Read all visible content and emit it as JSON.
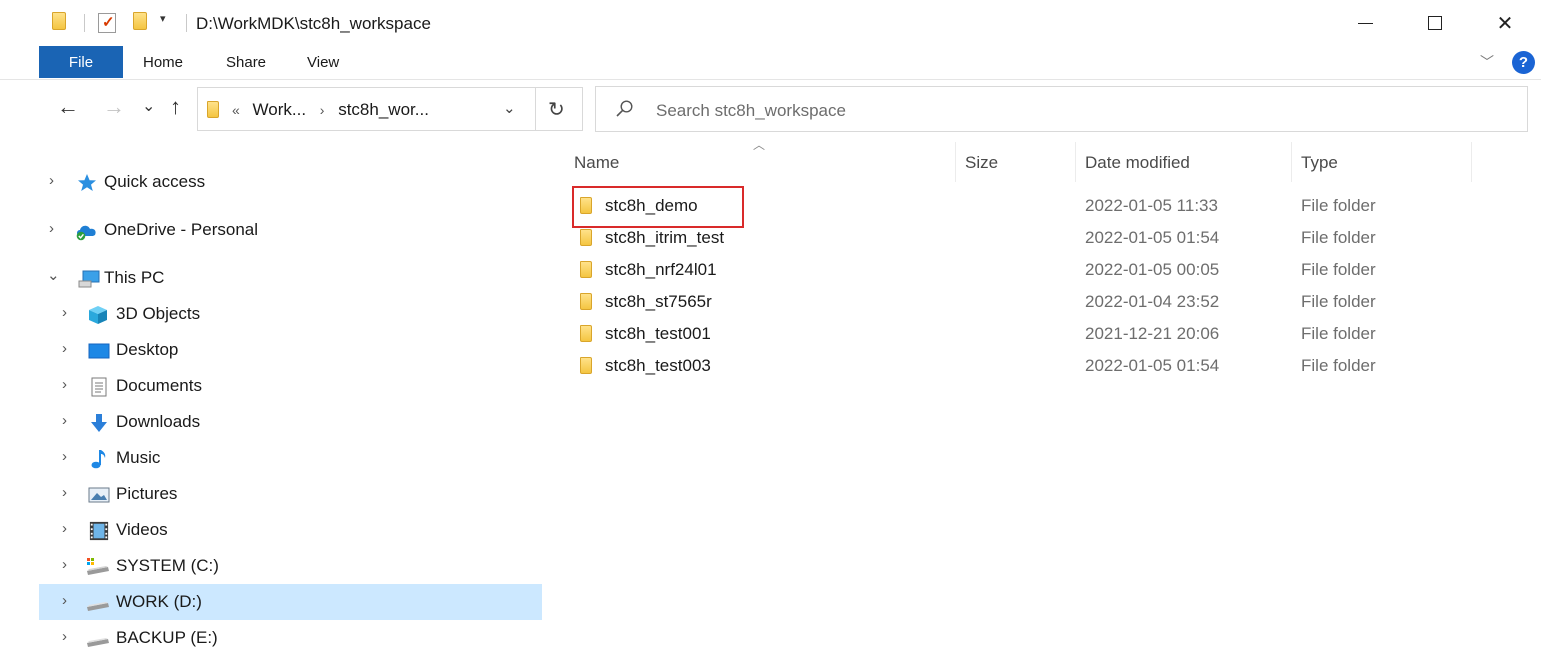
{
  "titlebar": {
    "path": "D:\\WorkMDK\\stc8h_workspace",
    "qa_dropdown": "▾",
    "minimize_icon": "minimize-icon",
    "maximize_icon": "maximize-icon",
    "close_glyph": "✕"
  },
  "ribbon": {
    "tabs": [
      "File",
      "Home",
      "Share",
      "View"
    ],
    "collapse_glyph": "﹀",
    "help_glyph": "?",
    "accent": "#1a64b4"
  },
  "nav": {
    "back_glyph": "←",
    "forward_glyph": "→",
    "recent_glyph": "⌄",
    "up_glyph": "↑",
    "overflow_glyph": "«",
    "breadcrumb": [
      "Work...",
      "stc8h_wor..."
    ],
    "crumb_sep": "›",
    "dropdown_glyph": "⌄",
    "refresh_glyph": "↻",
    "search_placeholder": "Search stc8h_workspace"
  },
  "sidebar": {
    "items": [
      {
        "label": "Quick access",
        "chevron": "›",
        "icon": "star-icon"
      },
      {
        "label": "OneDrive - Personal",
        "chevron": "›",
        "icon": "cloud-icon"
      },
      {
        "label": "This PC",
        "chevron": "⌄",
        "icon": "computer-icon"
      },
      {
        "label": "3D Objects",
        "chevron": "›",
        "icon": "cube-icon"
      },
      {
        "label": "Desktop",
        "chevron": "›",
        "icon": "desktop-icon"
      },
      {
        "label": "Documents",
        "chevron": "›",
        "icon": "document-icon"
      },
      {
        "label": "Downloads",
        "chevron": "›",
        "icon": "download-icon"
      },
      {
        "label": "Music",
        "chevron": "›",
        "icon": "music-icon"
      },
      {
        "label": "Pictures",
        "chevron": "›",
        "icon": "picture-icon"
      },
      {
        "label": "Videos",
        "chevron": "›",
        "icon": "video-icon"
      },
      {
        "label": "SYSTEM (C:)",
        "chevron": "›",
        "icon": "drive-icon"
      },
      {
        "label": "WORK (D:)",
        "chevron": "›",
        "icon": "drive-icon",
        "selected": true
      },
      {
        "label": "BACKUP (E:)",
        "chevron": "›",
        "icon": "drive-icon"
      }
    ],
    "selected_color": "#cce8ff"
  },
  "list": {
    "sort_glyph": "︿",
    "columns": [
      "Name",
      "Size",
      "Date modified",
      "Type"
    ],
    "rows": [
      {
        "name": "stc8h_demo",
        "date": "2022-01-05 11:33",
        "type": "File folder",
        "highlighted": true
      },
      {
        "name": "stc8h_itrim_test",
        "date": "2022-01-05 01:54",
        "type": "File folder"
      },
      {
        "name": "stc8h_nrf24l01",
        "date": "2022-01-05 00:05",
        "type": "File folder"
      },
      {
        "name": "stc8h_st7565r",
        "date": "2022-01-04 23:52",
        "type": "File folder"
      },
      {
        "name": "stc8h_test001",
        "date": "2021-12-21 20:06",
        "type": "File folder"
      },
      {
        "name": "stc8h_test003",
        "date": "2022-01-05 01:54",
        "type": "File folder"
      }
    ],
    "highlight_color": "#d92a2a"
  }
}
